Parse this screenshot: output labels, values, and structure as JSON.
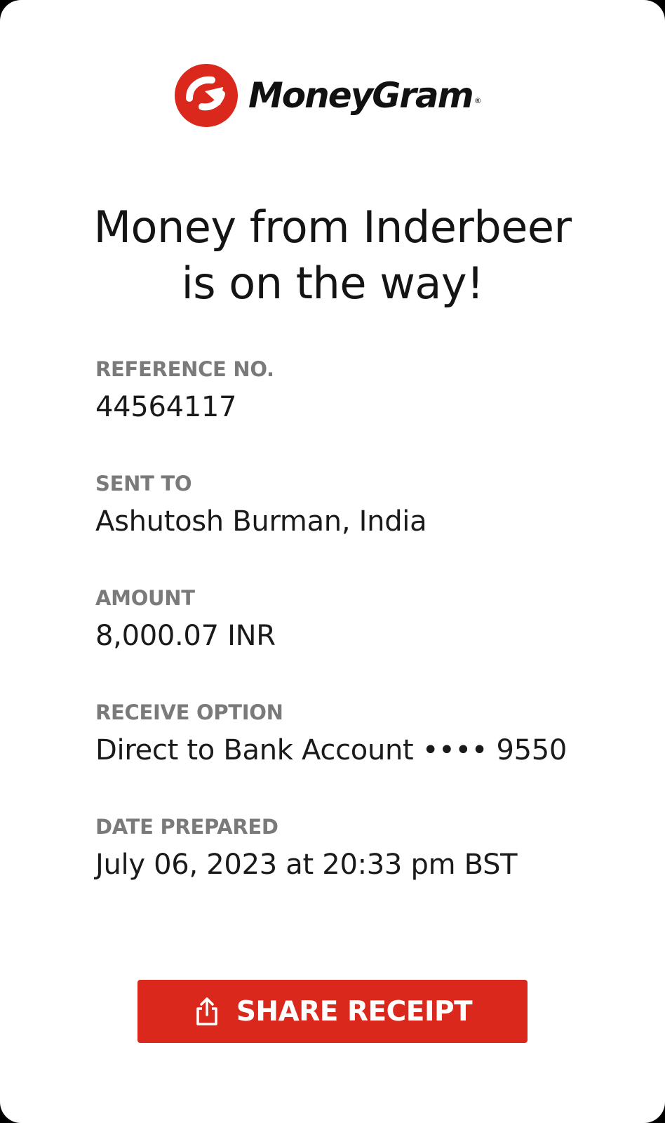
{
  "brand": {
    "name": "MoneyGram",
    "registered_mark": "®",
    "logo_icon": "moneygram-arrow-logo-icon",
    "accent_color": "#da291c"
  },
  "headline": {
    "line1": "Money from Inderbeer",
    "line2": "is on the way!"
  },
  "details": {
    "reference": {
      "label": "REFERENCE NO.",
      "value": "44564117"
    },
    "sent_to": {
      "label": "SENT TO",
      "value": "Ashutosh Burman, India"
    },
    "amount": {
      "label": "AMOUNT",
      "value": "8,000.07 INR"
    },
    "receive_option": {
      "label": "RECEIVE OPTION",
      "value": "Direct to Bank Account •••• 9550"
    },
    "date_prepared": {
      "label": "DATE PREPARED",
      "value": "July 06, 2023 at 20:33 pm BST"
    }
  },
  "actions": {
    "share_label": "SHARE RECEIPT",
    "share_icon": "share-icon"
  }
}
